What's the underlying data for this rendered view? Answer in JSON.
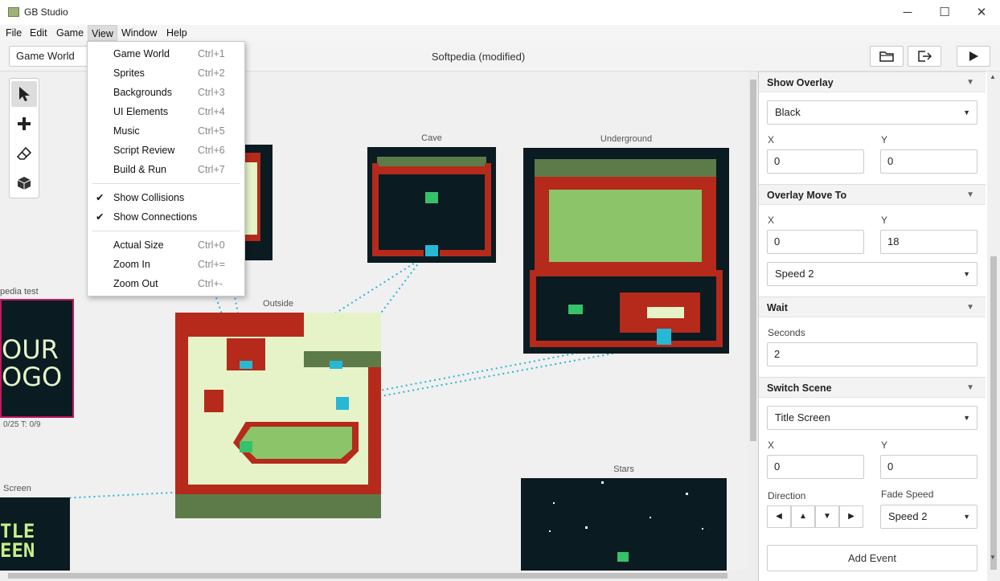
{
  "window": {
    "title": "GB Studio",
    "minimize": "─",
    "maximize": "☐",
    "close": "✕"
  },
  "menubar": [
    "File",
    "Edit",
    "Game",
    "View",
    "Window",
    "Help"
  ],
  "toolbar": {
    "section": "Game World",
    "project_title": "Softpedia (modified)"
  },
  "view_menu": {
    "items": [
      {
        "label": "Game World",
        "shortcut": "Ctrl+1"
      },
      {
        "label": "Sprites",
        "shortcut": "Ctrl+2"
      },
      {
        "label": "Backgrounds",
        "shortcut": "Ctrl+3"
      },
      {
        "label": "UI Elements",
        "shortcut": "Ctrl+4"
      },
      {
        "label": "Music",
        "shortcut": "Ctrl+5"
      },
      {
        "label": "Script Review",
        "shortcut": "Ctrl+6"
      },
      {
        "label": "Build & Run",
        "shortcut": "Ctrl+7"
      }
    ],
    "toggles": [
      {
        "label": "Show Collisions",
        "checked": "✔"
      },
      {
        "label": "Show Connections",
        "checked": "✔"
      }
    ],
    "zoom": [
      {
        "label": "Actual Size",
        "shortcut": "Ctrl+0"
      },
      {
        "label": "Zoom In",
        "shortcut": "Ctrl+="
      },
      {
        "label": "Zoom Out",
        "shortcut": "Ctrl+-"
      }
    ]
  },
  "scenes": {
    "cave": "Cave",
    "underground": "Underground",
    "outside": "Outside",
    "stars": "Stars",
    "logo_test": "pedia test",
    "logo_text_1": "OUR",
    "logo_text_2": "OGO",
    "logo_stats": "0/25   T: 0/9",
    "title_screen": "Screen",
    "title_text_1": "TLE",
    "title_text_2": "EEN"
  },
  "sidebar": {
    "show_overlay": {
      "title": "Show Overlay",
      "color": "Black",
      "x_label": "X",
      "y_label": "Y",
      "x": "0",
      "y": "0"
    },
    "overlay_move_to": {
      "title": "Overlay Move To",
      "x_label": "X",
      "y_label": "Y",
      "x": "0",
      "y": "18",
      "speed": "Speed 2"
    },
    "wait": {
      "title": "Wait",
      "seconds_label": "Seconds",
      "seconds": "2"
    },
    "switch_scene": {
      "title": "Switch Scene",
      "scene": "Title Screen",
      "x_label": "X",
      "y_label": "Y",
      "x": "0",
      "y": "0",
      "direction_label": "Direction",
      "fade_label": "Fade Speed",
      "fade": "Speed 2",
      "dirs": [
        "◀",
        "▲",
        "▼",
        "▶"
      ]
    },
    "add_event": "Add Event"
  },
  "colors": {
    "gb_dark": "#0a1b22",
    "gb_red": "#b52a1a",
    "gb_green": "#8cc46a",
    "gb_light": "#e6f3c8",
    "connection": "#26b8d4"
  }
}
